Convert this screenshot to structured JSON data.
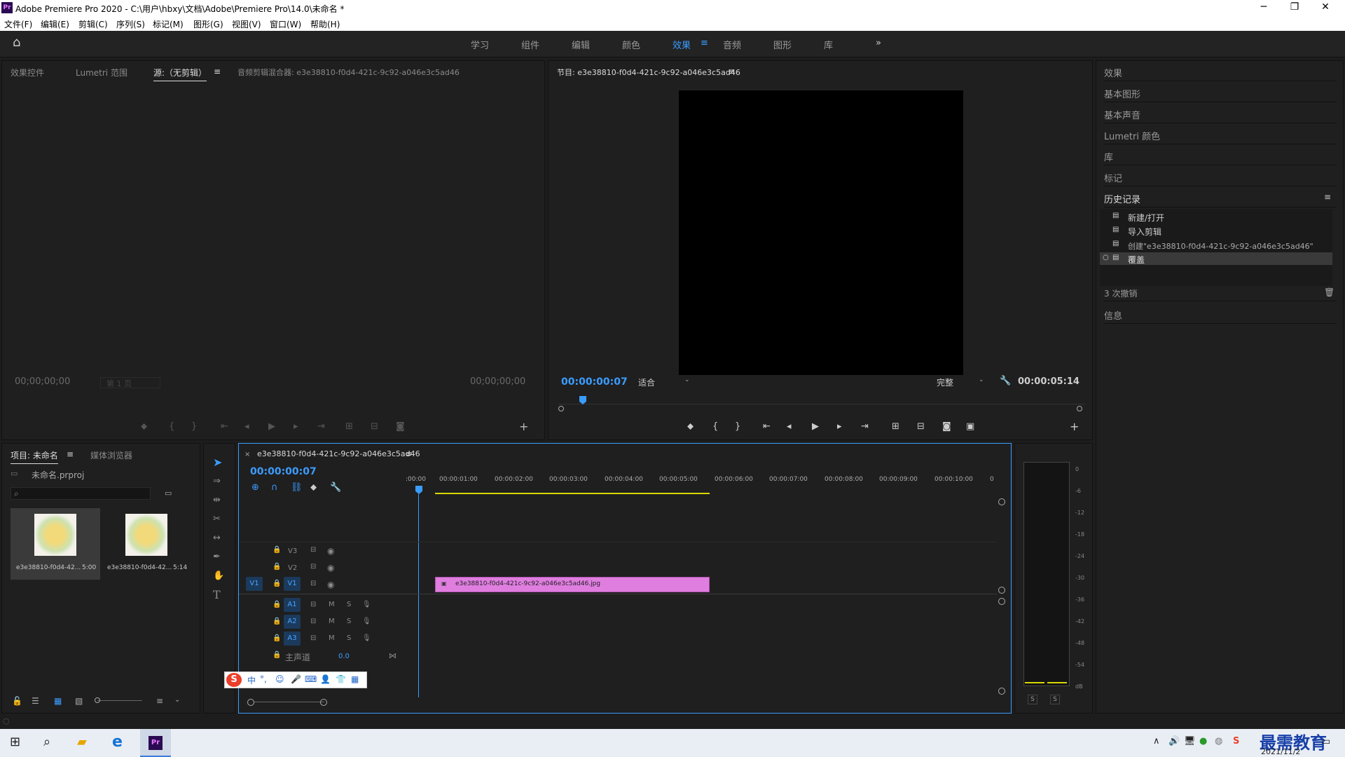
{
  "title_bar": {
    "app_icon": "Pr",
    "title": "Adobe Premiere Pro 2020 - C:\\用户\\hbxy\\文档\\Adobe\\Premiere Pro\\14.0\\未命名 *"
  },
  "menu": [
    "文件(F)",
    "编辑(E)",
    "剪辑(C)",
    "序列(S)",
    "标记(M)",
    "图形(G)",
    "视图(V)",
    "窗口(W)",
    "帮助(H)"
  ],
  "workspaces": [
    "学习",
    "组件",
    "编辑",
    "颜色",
    "效果",
    "音频",
    "图形",
    "库"
  ],
  "workspace_active": "效果",
  "accent_color": "#3b9cff",
  "source_panel": {
    "tabs": [
      "效果控件",
      "Lumetri 范围",
      "源:（无剪辑）",
      "音频剪辑混合器: e3e38810-f0d4-421c-9c92-a046e3c5ad46"
    ],
    "timecode_left": "00;00;00;00",
    "page_select": "第 1 页",
    "timecode_right": "00;00;00;00"
  },
  "program_panel": {
    "tab": "节目: e3e38810-f0d4-421c-9c92-a046e3c5ad46",
    "timecode": "00:00:00:07",
    "fit": "适合",
    "quality": "完整",
    "duration": "00:00:05:14"
  },
  "right_panel": {
    "items_top": [
      "效果",
      "基本图形",
      "基本声音",
      "Lumetri 颜色",
      "库",
      "标记"
    ],
    "history_title": "历史记录",
    "history_items": [
      "新建/打开",
      "导入剪辑",
      "创建\"e3e38810-f0d4-421c-9c92-a046e3c5ad46\"",
      "覆盖"
    ],
    "undo_count": "3 次撤销",
    "info": "信息"
  },
  "project_panel": {
    "tabs": [
      "项目: 未命名",
      "媒体浏览器"
    ],
    "file": "未命名.prproj",
    "items": [
      {
        "name": "e3e38810-f0d4-42...",
        "dur": "5:00"
      },
      {
        "name": "e3e38810-f0d4-42...",
        "dur": "5:14"
      }
    ]
  },
  "timeline": {
    "tab": "e3e38810-f0d4-421c-9c92-a046e3c5ad46",
    "timecode": "00:00:00:07",
    "ruler": [
      ":00:00",
      "00:00:01:00",
      "00:00:02:00",
      "00:00:03:00",
      "00:00:04:00",
      "00:00:05:00",
      "00:00:06:00",
      "00:00:07:00",
      "00:00:08:00",
      "00:00:09:00",
      "00:00:10:00",
      "0"
    ],
    "video_tracks": [
      "V3",
      "V2",
      "V1"
    ],
    "audio_tracks": [
      "A1",
      "A2",
      "A3"
    ],
    "src_v": "V1",
    "m_label": "M",
    "s_label": "S",
    "master": "主声道",
    "master_val": "0.0",
    "clip": "e3e38810-f0d4-421c-9c92-a046e3c5ad46.jpg",
    "clip_color": "#e07ee0"
  },
  "meter": {
    "scale": [
      "0",
      "-6",
      "-12",
      "-18",
      "-24",
      "-30",
      "-36",
      "-42",
      "-48",
      "-54",
      "dB"
    ],
    "solo": [
      "S",
      "S"
    ]
  },
  "ime": {
    "label": "中"
  },
  "taskbar": {
    "date": "2021/11/2",
    "watermark": "最需教育"
  }
}
